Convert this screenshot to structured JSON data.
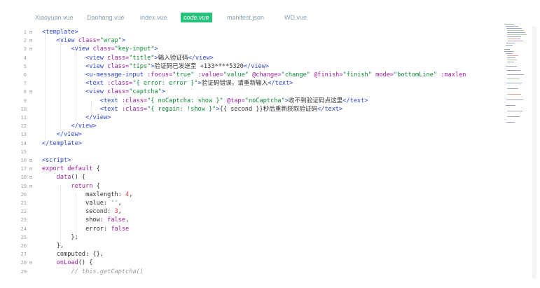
{
  "tabs": [
    {
      "label": "Xiaoyuan.vue",
      "active": false
    },
    {
      "label": "Daohang.vue",
      "active": false
    },
    {
      "label": "index.vue",
      "active": false
    },
    {
      "label": "code.vue",
      "active": true
    },
    {
      "label": "manifest.json",
      "active": false
    },
    {
      "label": "WD.vue",
      "active": false
    }
  ],
  "colors": {
    "active_tab": "#26c17a",
    "tag": "#2f47d6",
    "attribute": "#a21ea4",
    "string": "#118a3a",
    "number": "#e3303c",
    "comment": "#9a9a9a"
  },
  "lines": [
    {
      "n": "1",
      "f": "⊟",
      "segs": [
        [
          "tag",
          "<template>"
        ]
      ]
    },
    {
      "n": "2",
      "f": "⊟",
      "segs": [
        [
          "pl",
          "    "
        ],
        [
          "tag",
          "<view "
        ],
        [
          "attr",
          "class="
        ],
        [
          "str",
          "\"wrap\""
        ],
        [
          "tag",
          ">"
        ]
      ]
    },
    {
      "n": "3",
      "f": "⊟",
      "segs": [
        [
          "pl",
          "        "
        ],
        [
          "tag",
          "<view "
        ],
        [
          "attr",
          "class="
        ],
        [
          "str",
          "\"key-input\""
        ],
        [
          "tag",
          ">"
        ]
      ]
    },
    {
      "n": "4",
      "f": "",
      "segs": [
        [
          "pl",
          "            "
        ],
        [
          "tag",
          "<view "
        ],
        [
          "attr",
          "class="
        ],
        [
          "str",
          "\"title\""
        ],
        [
          "tag",
          ">"
        ],
        [
          "pl",
          "输入验证码"
        ],
        [
          "tag",
          "</view>"
        ]
      ]
    },
    {
      "n": "5",
      "f": "",
      "segs": [
        [
          "pl",
          "            "
        ],
        [
          "tag",
          "<view "
        ],
        [
          "attr",
          "class="
        ],
        [
          "str",
          "\"tips\""
        ],
        [
          "tag",
          ">"
        ],
        [
          "pl",
          "验证码已发送至 +133****5320"
        ],
        [
          "tag",
          "</view>"
        ]
      ]
    },
    {
      "n": "6",
      "f": "",
      "segs": [
        [
          "pl",
          "            "
        ],
        [
          "tag",
          "<u-message-input "
        ],
        [
          "attr",
          ":focus="
        ],
        [
          "str",
          "\"true\""
        ],
        [
          "attr",
          " :value="
        ],
        [
          "str",
          "\"value\""
        ],
        [
          "attr",
          " @change="
        ],
        [
          "str",
          "\"change\""
        ],
        [
          "attr",
          " @finish="
        ],
        [
          "str",
          "\"finish\""
        ],
        [
          "attr",
          " mode="
        ],
        [
          "str",
          "\"bottomLine\""
        ],
        [
          "attr",
          " :maxlen"
        ]
      ]
    },
    {
      "n": "7",
      "f": "",
      "segs": [
        [
          "pl",
          "            "
        ],
        [
          "tag",
          "<text "
        ],
        [
          "attr",
          ":class="
        ],
        [
          "str",
          "\"{ error: error }\""
        ],
        [
          "tag",
          ">"
        ],
        [
          "pl",
          "验证码错误，请重新输入"
        ],
        [
          "tag",
          "</text>"
        ]
      ]
    },
    {
      "n": "8",
      "f": "⊟",
      "segs": [
        [
          "pl",
          "            "
        ],
        [
          "tag",
          "<view "
        ],
        [
          "attr",
          "class="
        ],
        [
          "str",
          "\"captcha\""
        ],
        [
          "tag",
          ">"
        ]
      ]
    },
    {
      "n": "9",
      "f": "",
      "segs": [
        [
          "pl",
          "                "
        ],
        [
          "tag",
          "<text "
        ],
        [
          "attr",
          ":class="
        ],
        [
          "str",
          "\"{ noCaptcha: show }\""
        ],
        [
          "attr",
          " @tap="
        ],
        [
          "str",
          "\"noCaptcha\""
        ],
        [
          "tag",
          ">"
        ],
        [
          "pl",
          "收不到验证码点这里"
        ],
        [
          "tag",
          "</text>"
        ]
      ]
    },
    {
      "n": "10",
      "f": "",
      "segs": [
        [
          "pl",
          "                "
        ],
        [
          "tag",
          "<text "
        ],
        [
          "attr",
          ":class="
        ],
        [
          "str",
          "\"{ regain: !show }\""
        ],
        [
          "tag",
          ">"
        ],
        [
          "pl",
          "{{ second }}秒后重新获取验证码"
        ],
        [
          "tag",
          "</text>"
        ]
      ]
    },
    {
      "n": "11",
      "f": "",
      "segs": [
        [
          "pl",
          "            "
        ],
        [
          "tag",
          "</view>"
        ]
      ]
    },
    {
      "n": "12",
      "f": "",
      "segs": [
        [
          "pl",
          "        "
        ],
        [
          "tag",
          "</view>"
        ]
      ]
    },
    {
      "n": "13",
      "f": "",
      "segs": [
        [
          "pl",
          "    "
        ],
        [
          "tag",
          "</view>"
        ]
      ]
    },
    {
      "n": "14",
      "f": "",
      "segs": [
        [
          "tag",
          "</template>"
        ]
      ]
    },
    {
      "n": "15",
      "f": "",
      "segs": []
    },
    {
      "n": "16",
      "f": "⊟",
      "segs": [
        [
          "tag",
          "<script>"
        ]
      ]
    },
    {
      "n": "17",
      "f": "⊟",
      "segs": [
        [
          "kw",
          "export default "
        ],
        [
          "pl",
          "{"
        ]
      ]
    },
    {
      "n": "18",
      "f": "⊟",
      "segs": [
        [
          "pl",
          "    "
        ],
        [
          "kw",
          "data"
        ],
        [
          "pl",
          "() {"
        ]
      ]
    },
    {
      "n": "19",
      "f": "⊟",
      "segs": [
        [
          "pl",
          "        "
        ],
        [
          "kw",
          "return "
        ],
        [
          "pl",
          "{"
        ]
      ]
    },
    {
      "n": "20",
      "f": "",
      "segs": [
        [
          "pl",
          "            maxlength: "
        ],
        [
          "num",
          "4"
        ],
        [
          "pl",
          ","
        ]
      ]
    },
    {
      "n": "21",
      "f": "",
      "segs": [
        [
          "pl",
          "            value: "
        ],
        [
          "str",
          "''"
        ],
        [
          "pl",
          ","
        ]
      ]
    },
    {
      "n": "22",
      "f": "",
      "segs": [
        [
          "pl",
          "            second: "
        ],
        [
          "num",
          "3"
        ],
        [
          "pl",
          ","
        ]
      ]
    },
    {
      "n": "23",
      "f": "",
      "segs": [
        [
          "pl",
          "            show: "
        ],
        [
          "kw",
          "false"
        ],
        [
          "pl",
          ","
        ]
      ]
    },
    {
      "n": "24",
      "f": "",
      "segs": [
        [
          "pl",
          "            error: "
        ],
        [
          "kw",
          "false"
        ]
      ]
    },
    {
      "n": "25",
      "f": "",
      "segs": [
        [
          "pl",
          "        };"
        ]
      ]
    },
    {
      "n": "26",
      "f": "",
      "segs": [
        [
          "pl",
          "    },"
        ]
      ]
    },
    {
      "n": "27",
      "f": "",
      "segs": [
        [
          "pl",
          "    computed: {},"
        ]
      ]
    },
    {
      "n": "28",
      "f": "⊟",
      "segs": [
        [
          "pl",
          "    "
        ],
        [
          "kw",
          "onLoad"
        ],
        [
          "pl",
          "() {"
        ]
      ]
    },
    {
      "n": "29",
      "f": "",
      "segs": [
        [
          "pl",
          "        "
        ],
        [
          "cm",
          "// this.getCaptcha()"
        ]
      ]
    }
  ]
}
